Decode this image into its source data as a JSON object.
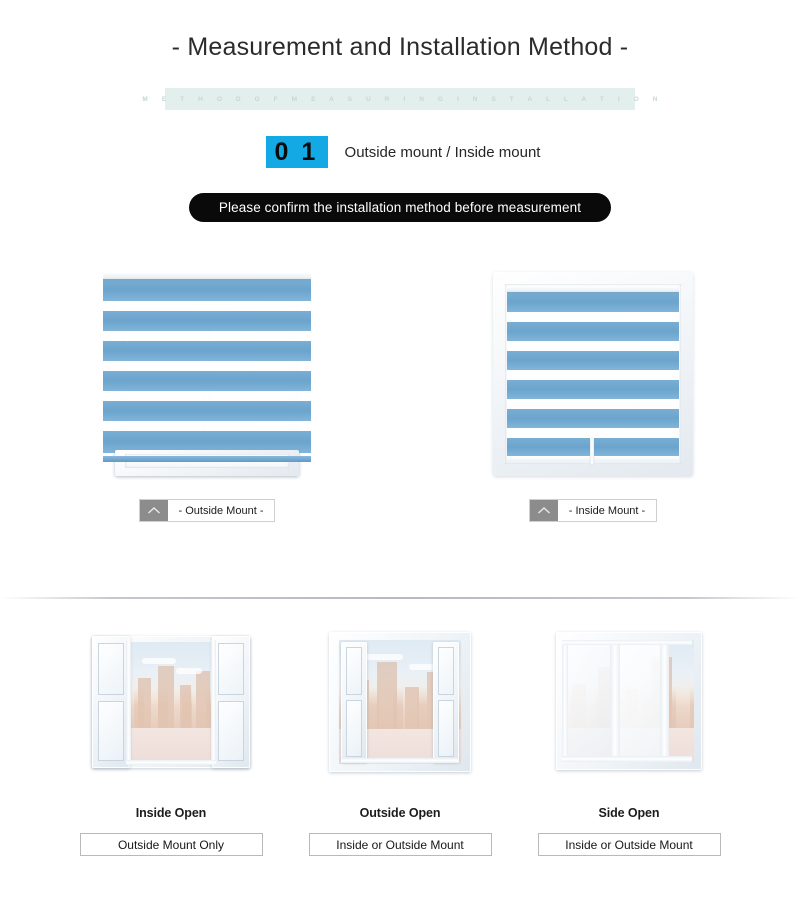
{
  "page": {
    "title": "- Measurement and Installation Method -",
    "band_text": "M E T H O D   O F   M E A S U R I N G   I N S T A L L A T I O N",
    "accent_cyan": "#12a9e5",
    "band_bg": "#e3efed",
    "blind_blue": "#6ba4cd",
    "pill_bg": "#0a0a0a"
  },
  "step": {
    "number": "0 1",
    "label": "Outside mount / Inside mount"
  },
  "notice": {
    "text": "Please confirm the installation method before measurement"
  },
  "mounts": [
    {
      "tag_label": "- Outside Mount -",
      "icon": "chevron-up-icon",
      "kind": "outside"
    },
    {
      "tag_label": "- Inside Mount -",
      "icon": "chevron-up-icon",
      "kind": "inside"
    }
  ],
  "window_types": [
    {
      "caption": "Inside Open",
      "recommendation": "Outside Mount Only"
    },
    {
      "caption": "Outside Open",
      "recommendation": "Inside or Outside Mount"
    },
    {
      "caption": "Side Open",
      "recommendation": "Inside or Outside Mount"
    }
  ]
}
